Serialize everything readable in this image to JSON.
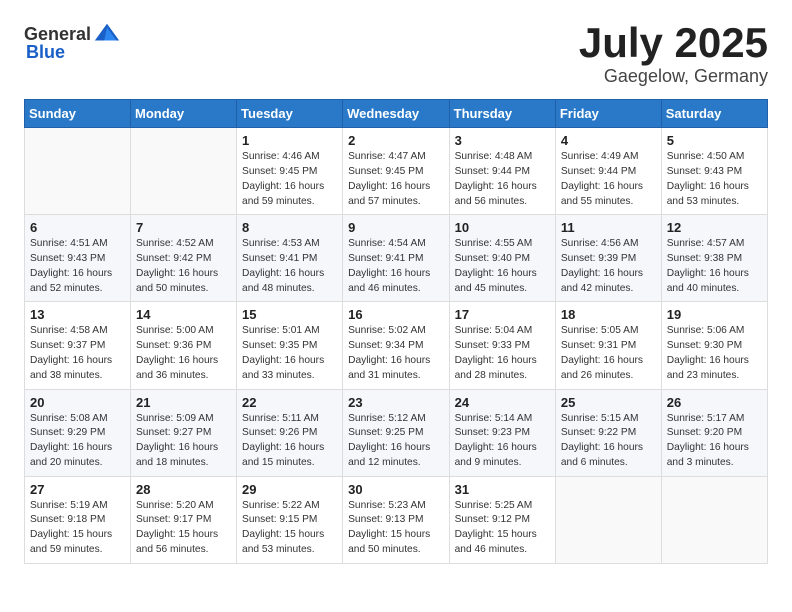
{
  "header": {
    "logo_general": "General",
    "logo_blue": "Blue",
    "month": "July 2025",
    "location": "Gaegelow, Germany"
  },
  "weekdays": [
    "Sunday",
    "Monday",
    "Tuesday",
    "Wednesday",
    "Thursday",
    "Friday",
    "Saturday"
  ],
  "weeks": [
    [
      {
        "day": "",
        "info": ""
      },
      {
        "day": "",
        "info": ""
      },
      {
        "day": "1",
        "info": "Sunrise: 4:46 AM\nSunset: 9:45 PM\nDaylight: 16 hours and 59 minutes."
      },
      {
        "day": "2",
        "info": "Sunrise: 4:47 AM\nSunset: 9:45 PM\nDaylight: 16 hours and 57 minutes."
      },
      {
        "day": "3",
        "info": "Sunrise: 4:48 AM\nSunset: 9:44 PM\nDaylight: 16 hours and 56 minutes."
      },
      {
        "day": "4",
        "info": "Sunrise: 4:49 AM\nSunset: 9:44 PM\nDaylight: 16 hours and 55 minutes."
      },
      {
        "day": "5",
        "info": "Sunrise: 4:50 AM\nSunset: 9:43 PM\nDaylight: 16 hours and 53 minutes."
      }
    ],
    [
      {
        "day": "6",
        "info": "Sunrise: 4:51 AM\nSunset: 9:43 PM\nDaylight: 16 hours and 52 minutes."
      },
      {
        "day": "7",
        "info": "Sunrise: 4:52 AM\nSunset: 9:42 PM\nDaylight: 16 hours and 50 minutes."
      },
      {
        "day": "8",
        "info": "Sunrise: 4:53 AM\nSunset: 9:41 PM\nDaylight: 16 hours and 48 minutes."
      },
      {
        "day": "9",
        "info": "Sunrise: 4:54 AM\nSunset: 9:41 PM\nDaylight: 16 hours and 46 minutes."
      },
      {
        "day": "10",
        "info": "Sunrise: 4:55 AM\nSunset: 9:40 PM\nDaylight: 16 hours and 45 minutes."
      },
      {
        "day": "11",
        "info": "Sunrise: 4:56 AM\nSunset: 9:39 PM\nDaylight: 16 hours and 42 minutes."
      },
      {
        "day": "12",
        "info": "Sunrise: 4:57 AM\nSunset: 9:38 PM\nDaylight: 16 hours and 40 minutes."
      }
    ],
    [
      {
        "day": "13",
        "info": "Sunrise: 4:58 AM\nSunset: 9:37 PM\nDaylight: 16 hours and 38 minutes."
      },
      {
        "day": "14",
        "info": "Sunrise: 5:00 AM\nSunset: 9:36 PM\nDaylight: 16 hours and 36 minutes."
      },
      {
        "day": "15",
        "info": "Sunrise: 5:01 AM\nSunset: 9:35 PM\nDaylight: 16 hours and 33 minutes."
      },
      {
        "day": "16",
        "info": "Sunrise: 5:02 AM\nSunset: 9:34 PM\nDaylight: 16 hours and 31 minutes."
      },
      {
        "day": "17",
        "info": "Sunrise: 5:04 AM\nSunset: 9:33 PM\nDaylight: 16 hours and 28 minutes."
      },
      {
        "day": "18",
        "info": "Sunrise: 5:05 AM\nSunset: 9:31 PM\nDaylight: 16 hours and 26 minutes."
      },
      {
        "day": "19",
        "info": "Sunrise: 5:06 AM\nSunset: 9:30 PM\nDaylight: 16 hours and 23 minutes."
      }
    ],
    [
      {
        "day": "20",
        "info": "Sunrise: 5:08 AM\nSunset: 9:29 PM\nDaylight: 16 hours and 20 minutes."
      },
      {
        "day": "21",
        "info": "Sunrise: 5:09 AM\nSunset: 9:27 PM\nDaylight: 16 hours and 18 minutes."
      },
      {
        "day": "22",
        "info": "Sunrise: 5:11 AM\nSunset: 9:26 PM\nDaylight: 16 hours and 15 minutes."
      },
      {
        "day": "23",
        "info": "Sunrise: 5:12 AM\nSunset: 9:25 PM\nDaylight: 16 hours and 12 minutes."
      },
      {
        "day": "24",
        "info": "Sunrise: 5:14 AM\nSunset: 9:23 PM\nDaylight: 16 hours and 9 minutes."
      },
      {
        "day": "25",
        "info": "Sunrise: 5:15 AM\nSunset: 9:22 PM\nDaylight: 16 hours and 6 minutes."
      },
      {
        "day": "26",
        "info": "Sunrise: 5:17 AM\nSunset: 9:20 PM\nDaylight: 16 hours and 3 minutes."
      }
    ],
    [
      {
        "day": "27",
        "info": "Sunrise: 5:19 AM\nSunset: 9:18 PM\nDaylight: 15 hours and 59 minutes."
      },
      {
        "day": "28",
        "info": "Sunrise: 5:20 AM\nSunset: 9:17 PM\nDaylight: 15 hours and 56 minutes."
      },
      {
        "day": "29",
        "info": "Sunrise: 5:22 AM\nSunset: 9:15 PM\nDaylight: 15 hours and 53 minutes."
      },
      {
        "day": "30",
        "info": "Sunrise: 5:23 AM\nSunset: 9:13 PM\nDaylight: 15 hours and 50 minutes."
      },
      {
        "day": "31",
        "info": "Sunrise: 5:25 AM\nSunset: 9:12 PM\nDaylight: 15 hours and 46 minutes."
      },
      {
        "day": "",
        "info": ""
      },
      {
        "day": "",
        "info": ""
      }
    ]
  ]
}
